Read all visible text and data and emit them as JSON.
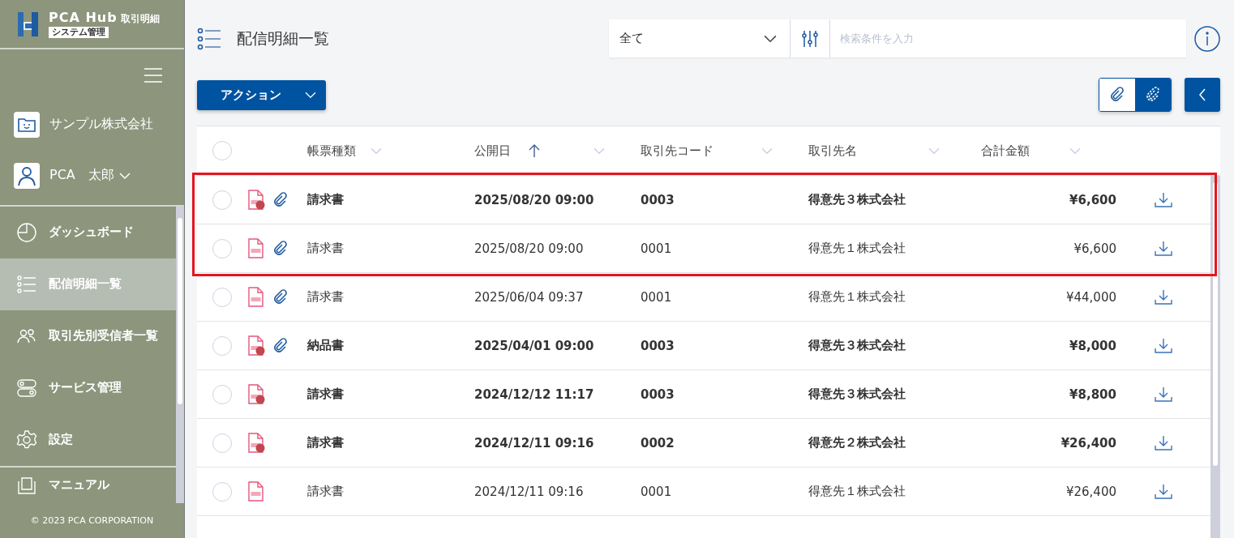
{
  "sidebar": {
    "logo": {
      "brand": "PCA Hub",
      "product": "取引明細",
      "edition": "システム管理"
    },
    "company": "サンプル株式会社",
    "user": "PCA　太郎",
    "nav": [
      {
        "label": "ダッシュボード",
        "kind": "dashboard",
        "selected": false
      },
      {
        "label": "配信明細一覧",
        "kind": "list",
        "selected": true
      },
      {
        "label": "取引先別受信者一覧",
        "kind": "people",
        "selected": false
      },
      {
        "label": "サービス管理",
        "kind": "toggle",
        "selected": false
      },
      {
        "label": "設定",
        "kind": "gear",
        "selected": false
      },
      {
        "label": "マニュアル",
        "kind": "manual",
        "selected": false
      }
    ],
    "copyright": "© 2023 PCA CORPORATION"
  },
  "page_title": "配信明細一覧",
  "search": {
    "scope": "全て",
    "placeholder": "検索条件を入力"
  },
  "action_button": "アクション",
  "attachment_toggle": [
    {
      "kind": "clip",
      "selected": false
    },
    {
      "kind": "clip-dashed",
      "selected": true
    }
  ],
  "table": {
    "select_all": {
      "checked": false
    },
    "columns": [
      {
        "label": "帳票種類",
        "sorted": false
      },
      {
        "label": "公開日",
        "sorted": true
      },
      {
        "label": "取引先コード",
        "sorted": false
      },
      {
        "label": "取引先名",
        "sorted": false
      },
      {
        "label": "合計金額",
        "sorted": false
      }
    ],
    "rows": [
      {
        "selected": false,
        "unread": true,
        "attachment": true,
        "highlighted": true,
        "document_type": "請求書",
        "published": "2025/08/20 09:00",
        "partner_code": "0003",
        "partner_name": "得意先３株式会社",
        "total": "¥6,600"
      },
      {
        "selected": false,
        "unread": false,
        "attachment": true,
        "highlighted": true,
        "document_type": "請求書",
        "published": "2025/08/20 09:00",
        "partner_code": "0001",
        "partner_name": "得意先１株式会社",
        "total": "¥6,600"
      },
      {
        "selected": false,
        "unread": false,
        "attachment": true,
        "highlighted": false,
        "document_type": "請求書",
        "published": "2025/06/04 09:37",
        "partner_code": "0001",
        "partner_name": "得意先１株式会社",
        "total": "¥44,000"
      },
      {
        "selected": false,
        "unread": true,
        "attachment": true,
        "highlighted": false,
        "document_type": "納品書",
        "published": "2025/04/01 09:00",
        "partner_code": "0003",
        "partner_name": "得意先３株式会社",
        "total": "¥8,000"
      },
      {
        "selected": false,
        "unread": true,
        "attachment": false,
        "highlighted": false,
        "document_type": "請求書",
        "published": "2024/12/12 11:17",
        "partner_code": "0003",
        "partner_name": "得意先３株式会社",
        "total": "¥8,800"
      },
      {
        "selected": false,
        "unread": true,
        "attachment": false,
        "highlighted": false,
        "document_type": "請求書",
        "published": "2024/12/11 09:16",
        "partner_code": "0002",
        "partner_name": "得意先２株式会社",
        "total": "¥26,400"
      },
      {
        "selected": false,
        "unread": false,
        "attachment": false,
        "highlighted": false,
        "document_type": "請求書",
        "published": "2024/12/11 09:16",
        "partner_code": "0001",
        "partner_name": "得意先１株式会社",
        "total": "¥26,400"
      }
    ]
  }
}
